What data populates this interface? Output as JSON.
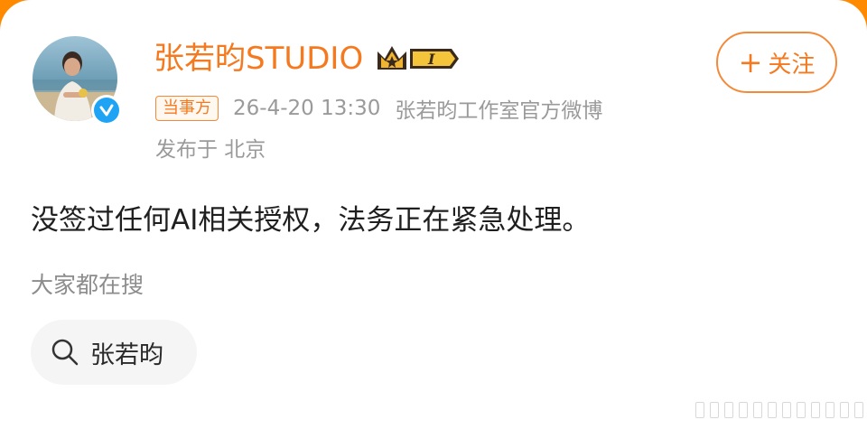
{
  "post": {
    "user_name": "张若昀STUDIO",
    "vip_level": "I",
    "follow_label": "关注",
    "tag": "当事方",
    "timestamp": "26-4-20 13:30",
    "source": "张若昀工作室官方微博",
    "location": "发布于 北京",
    "content": "没签过任何AI相关授权，法务正在紧急处理。"
  },
  "related": {
    "label": "大家都在搜",
    "search_term": "张若昀"
  },
  "colors": {
    "accent": "#f57a1f",
    "verified": "#1fa3f4",
    "top_bar": "#ff8a00"
  }
}
